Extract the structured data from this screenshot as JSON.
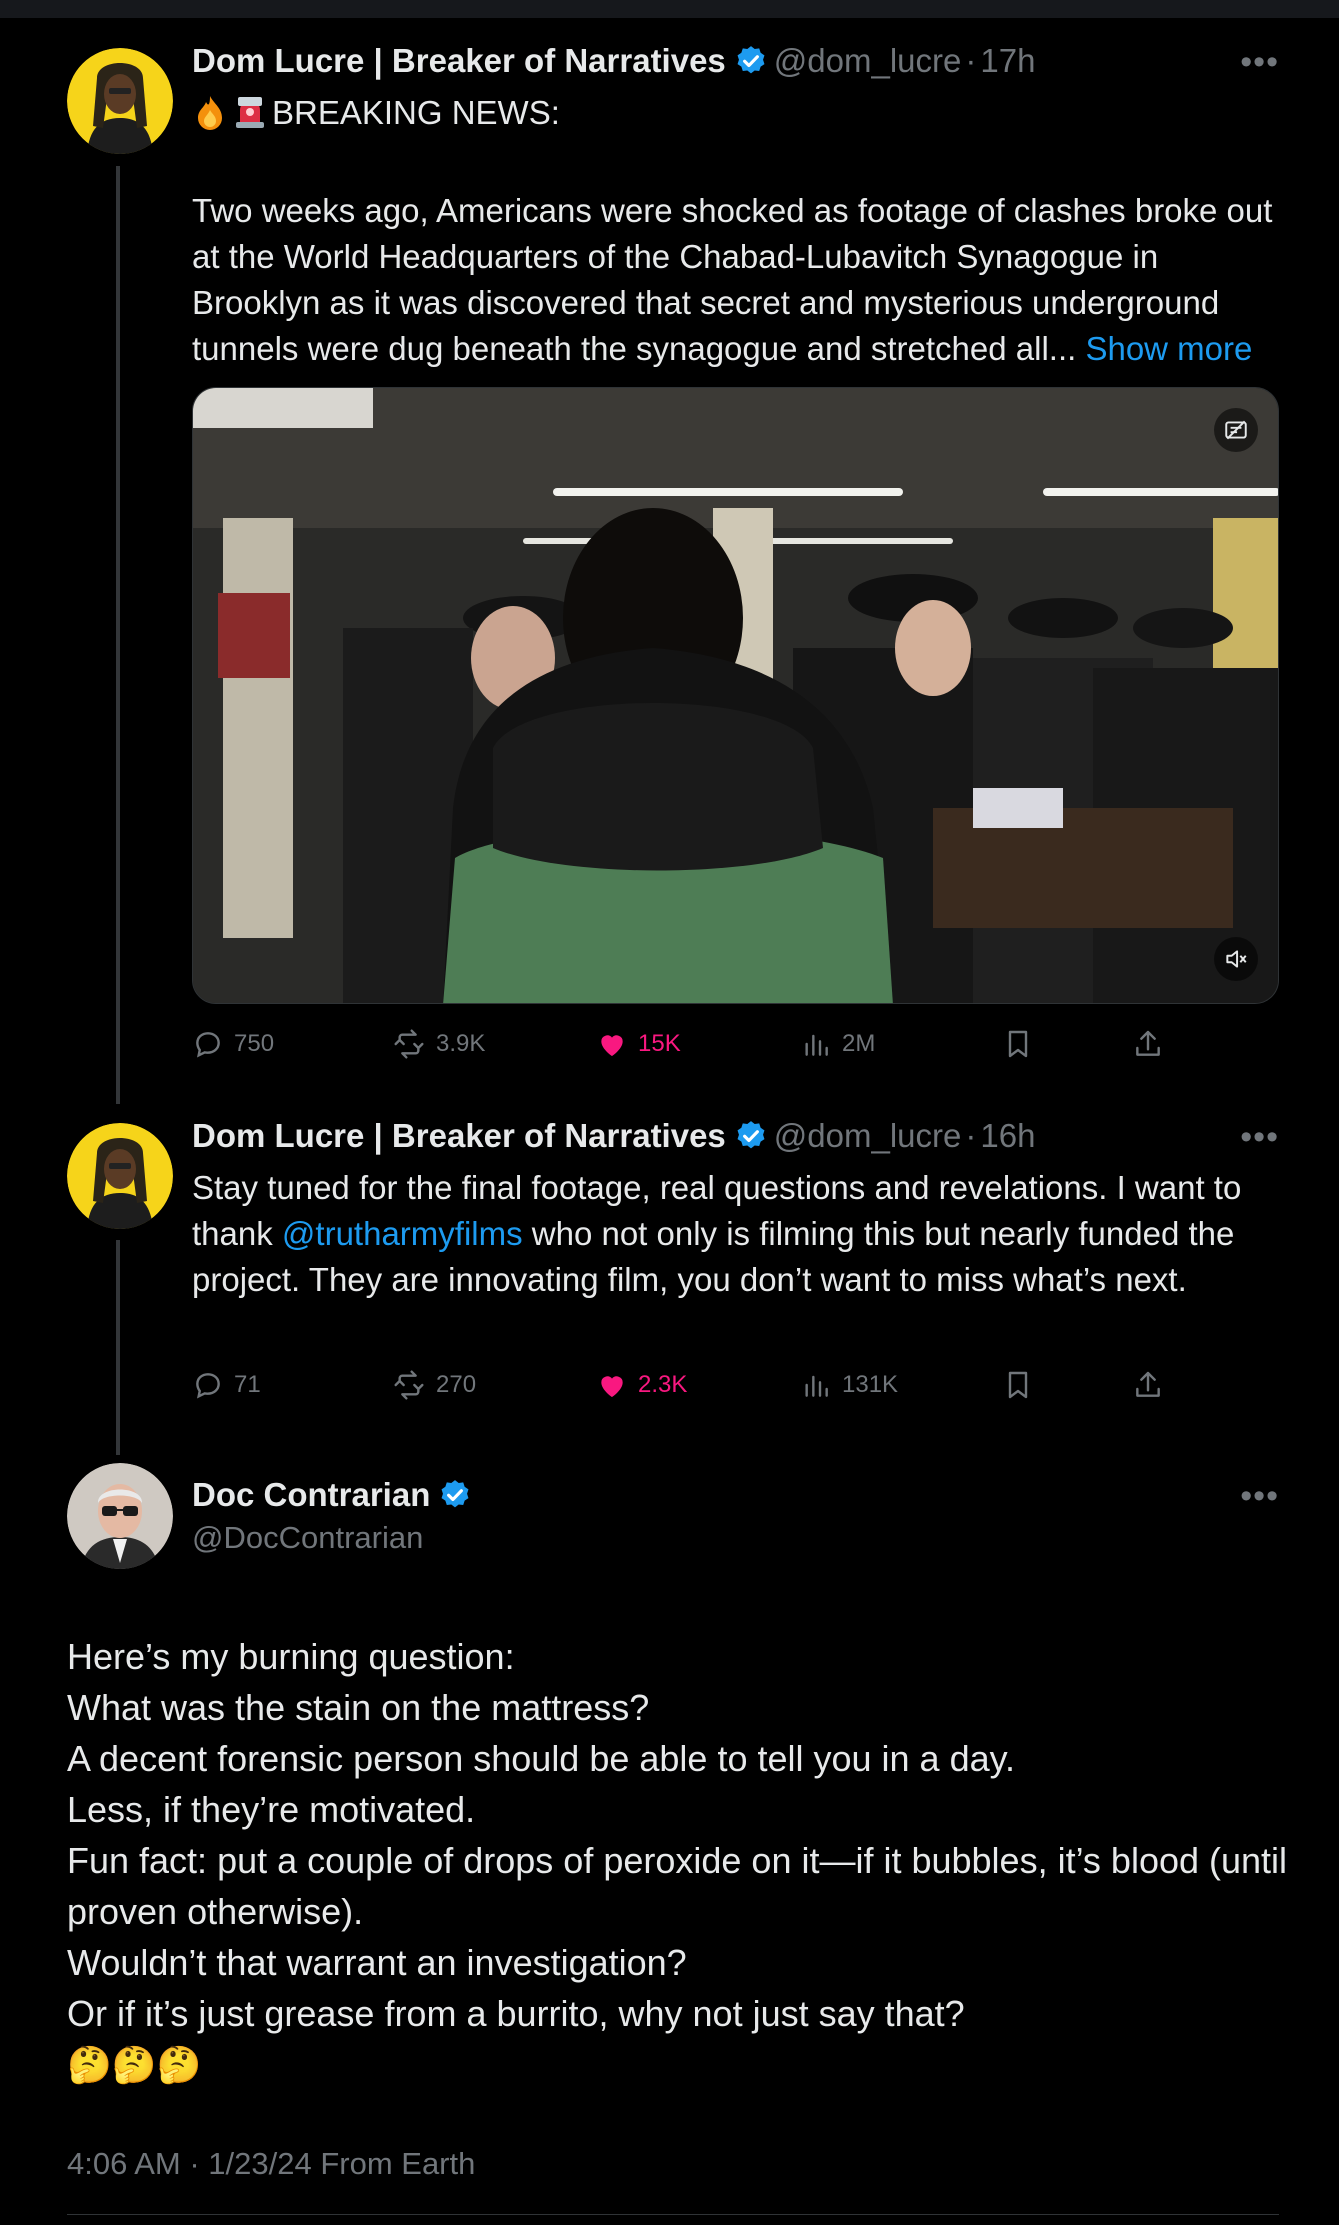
{
  "tweet1": {
    "name": "Dom Lucre | Breaker of Narratives",
    "handle": "@dom_lucre",
    "dot": "·",
    "time": "17h",
    "headline": "BREAKING NEWS:",
    "body": "Two weeks ago, Americans were shocked as footage of clashes broke out at the World Headquarters of the Chabad-Lubavitch Synagogue in Brooklyn as it was discovered that secret and mysterious underground tunnels were dug beneath the synagogue and stretched all...",
    "show_more": "Show more",
    "stats": {
      "replies": "750",
      "reposts": "3.9K",
      "likes": "15K",
      "views": "2M"
    }
  },
  "tweet2": {
    "name": "Dom Lucre | Breaker of Narratives",
    "handle": "@dom_lucre",
    "dot": "·",
    "time": "16h",
    "text_before": "Stay tuned for the final footage, real questions and revelations. I want to thank",
    "mention": "@trutharmyfilms",
    "text_after": "who not only is filming this but nearly funded the project. They are innovating film, you don’t want to miss what’s next.",
    "stats": {
      "replies": "71",
      "reposts": "270",
      "likes": "2.3K",
      "views": "131K"
    }
  },
  "main": {
    "name": "Doc Contrarian",
    "handle": "@DocContrarian",
    "lines": [
      "Here’s my burning question:",
      "What was the stain on the mattress?",
      "A decent forensic person should be able to tell you in a day.",
      "Less, if they’re motivated.",
      "Fun fact: put a couple of drops of peroxide on it—if it bubbles, it’s blood (until proven otherwise).",
      "Wouldn’t that warrant an investigation?",
      "Or if it’s just grease from a burrito, why not just say that?"
    ],
    "emojis": "🤔🤔🤔",
    "timestamp": "4:06 AM · 1/23/24 From Earth"
  },
  "icons": {
    "verified": "verified-badge-icon",
    "more": "more-icon",
    "reply": "reply-icon",
    "repost": "repost-icon",
    "like": "heart-icon",
    "views": "views-icon",
    "bookmark": "bookmark-icon",
    "share": "share-icon",
    "mute": "mute-icon",
    "alt": "alt-text-icon"
  },
  "colors": {
    "accent": "#1d9bf0",
    "like": "#f91880",
    "muted": "#71767b",
    "text": "#e7e9ea"
  }
}
